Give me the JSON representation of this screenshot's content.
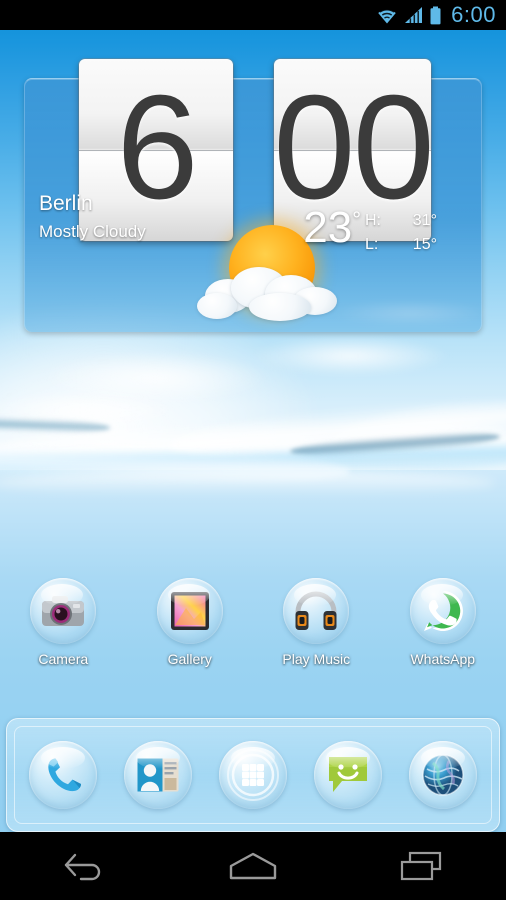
{
  "status_bar": {
    "time": "6:00",
    "icons": [
      "wifi-icon",
      "cellular-signal-icon",
      "battery-icon"
    ],
    "accent_color": "#5fb9e8",
    "background_color": "#000000"
  },
  "clock_widget": {
    "hours": "6",
    "minutes": "00",
    "weather": {
      "city": "Berlin",
      "condition": "Mostly Cloudy",
      "temperature": "23",
      "degree_symbol": "°",
      "high_label": "H:",
      "high_value": "31°",
      "low_label": "L:",
      "low_value": "15°",
      "condition_icon": "sun-behind-cloud-icon"
    },
    "panel_color": "#3e96d6"
  },
  "app_row": [
    {
      "label": "Camera",
      "icon": "camera-icon"
    },
    {
      "label": "Gallery",
      "icon": "gallery-icon"
    },
    {
      "label": "Play Music",
      "icon": "headphones-icon"
    },
    {
      "label": "WhatsApp",
      "icon": "whatsapp-icon"
    }
  ],
  "dock": [
    {
      "name": "Phone",
      "icon": "phone-handset-icon"
    },
    {
      "name": "Contacts",
      "icon": "contact-card-icon"
    },
    {
      "name": "Apps",
      "icon": "app-drawer-grid-icon"
    },
    {
      "name": "Messaging",
      "icon": "message-smiley-icon"
    },
    {
      "name": "Browser",
      "icon": "globe-icon"
    }
  ],
  "nav_bar": [
    {
      "name": "Back",
      "icon": "back-arrow-icon"
    },
    {
      "name": "Home",
      "icon": "home-icon"
    },
    {
      "name": "Recents",
      "icon": "recent-apps-icon"
    }
  ],
  "wallpaper": {
    "description": "ocean-water-horizon",
    "sky_color": "#1895dd",
    "sea_color": "#9ad3f2"
  }
}
